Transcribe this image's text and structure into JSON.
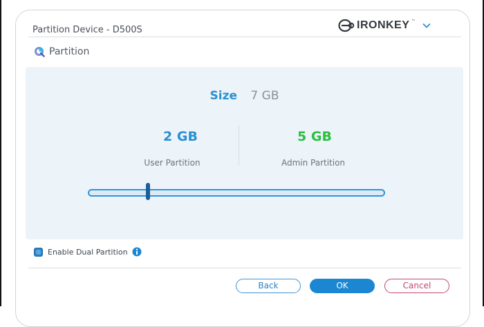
{
  "window": {
    "title": "Partition Device - D500S"
  },
  "brand": {
    "name": "IRONKEY",
    "trademark": "™"
  },
  "section": {
    "title": "Partition"
  },
  "partition": {
    "size_label": "Size",
    "size_value": "7 GB",
    "user_value": "2 GB",
    "user_label": "User Partition",
    "admin_value": "5 GB",
    "admin_label": "Admin Partition",
    "slider_fraction": 0.2857
  },
  "options": {
    "enable_dual_label": "Enable Dual Partition",
    "enable_dual_checked": true
  },
  "buttons": {
    "back": "Back",
    "ok": "OK",
    "cancel": "Cancel"
  },
  "colors": {
    "accent_blue": "#2b8fd0",
    "admin_green": "#2bbf3f",
    "cancel_red": "#c2456f",
    "panel_bg": "#ecf4fa"
  }
}
